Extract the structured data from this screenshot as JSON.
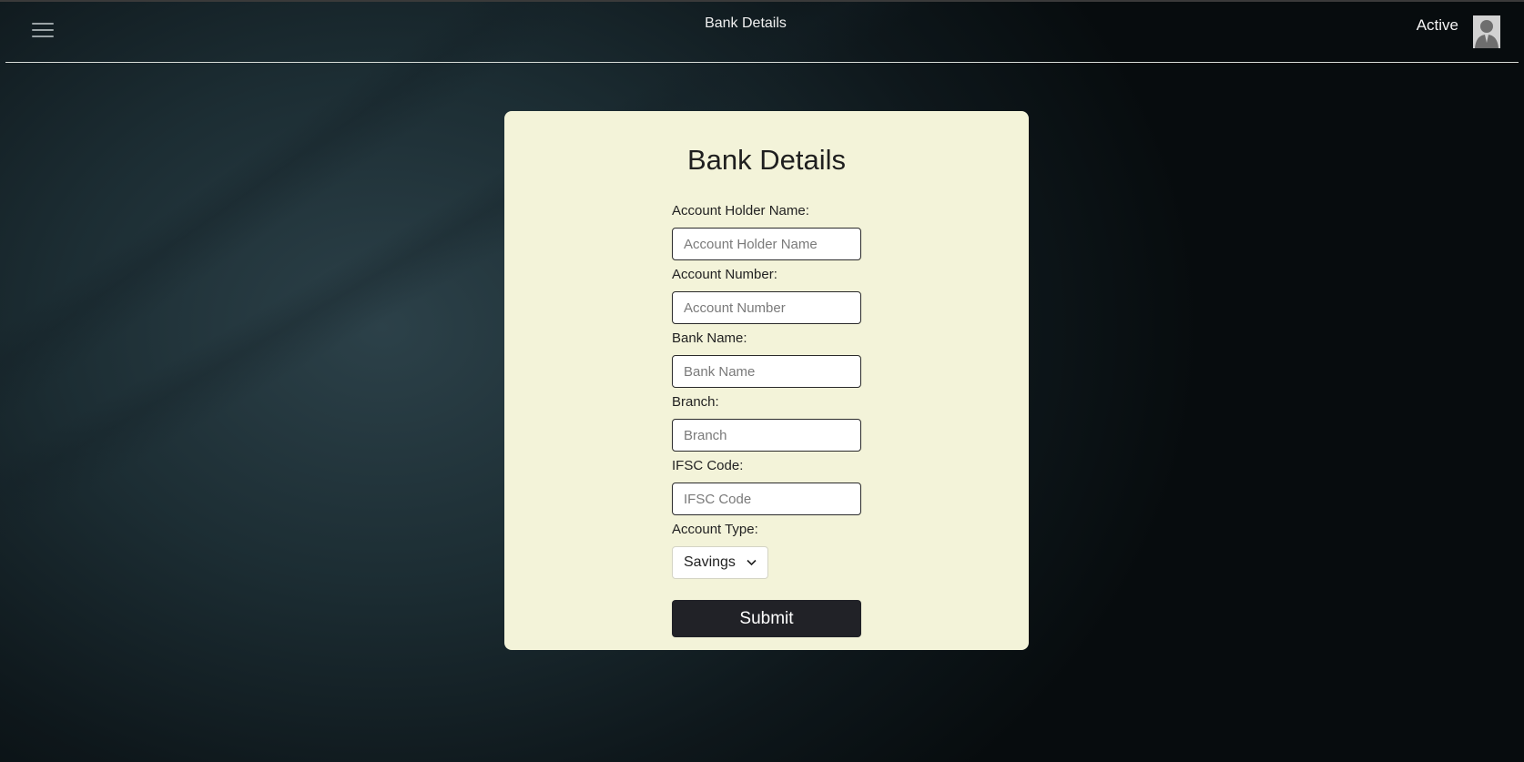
{
  "header": {
    "title": "Bank Details",
    "status": "Active",
    "menu_icon": "hamburger-icon",
    "avatar_icon": "user-avatar-icon"
  },
  "form": {
    "title": "Bank Details",
    "fields": [
      {
        "label": "Account Holder Name:",
        "placeholder": "Account Holder Name",
        "value": ""
      },
      {
        "label": "Account Number:",
        "placeholder": "Account Number",
        "value": ""
      },
      {
        "label": "Bank Name:",
        "placeholder": "Bank Name",
        "value": ""
      },
      {
        "label": "Branch:",
        "placeholder": "Branch",
        "value": ""
      },
      {
        "label": "IFSC Code:",
        "placeholder": "IFSC Code",
        "value": ""
      }
    ],
    "account_type": {
      "label": "Account Type:",
      "selected": "Savings"
    },
    "submit_label": "Submit"
  },
  "colors": {
    "card_background": "#f3f3d9",
    "button_background": "#212227",
    "header_text": "#f0f0f0"
  }
}
